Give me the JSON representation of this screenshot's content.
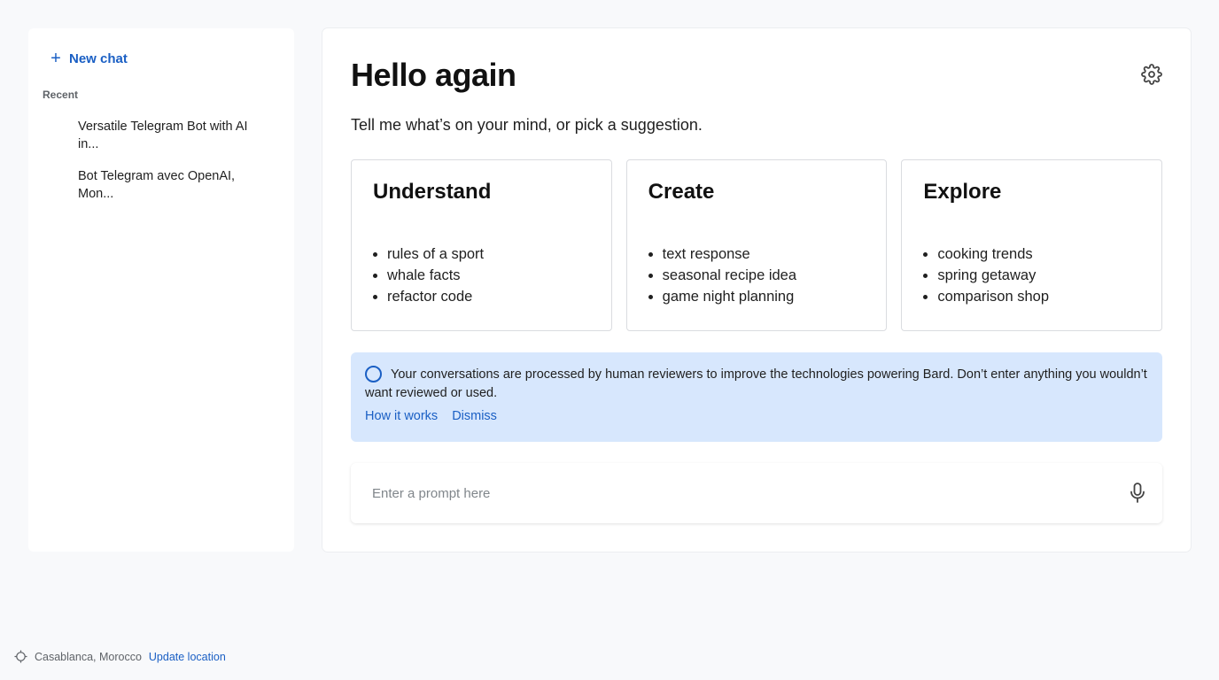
{
  "sidebar": {
    "new_chat_label": "New chat",
    "recent_label": "Recent",
    "items": [
      {
        "label": "Versatile Telegram Bot with AI in..."
      },
      {
        "label": "Bot Telegram avec OpenAI, Mon..."
      }
    ]
  },
  "main": {
    "title": "Hello again",
    "subtitle": "Tell me what’s on your mind, or pick a suggestion.",
    "cards": [
      {
        "title": "Understand",
        "items": [
          "rules of a sport",
          "whale facts",
          "refactor code"
        ]
      },
      {
        "title": "Create",
        "items": [
          "text response",
          "seasonal recipe idea",
          "game night planning"
        ]
      },
      {
        "title": "Explore",
        "items": [
          "cooking trends",
          "spring getaway",
          "comparison shop"
        ]
      }
    ],
    "notice": {
      "text": "Your conversations are processed by human reviewers to improve the technologies powering Bard. Don’t enter anything you wouldn’t want reviewed or used.",
      "how_it_works": "How it works",
      "dismiss": "Dismiss"
    },
    "prompt": {
      "placeholder": "Enter a prompt here",
      "value": ""
    }
  },
  "footer": {
    "location": "Casablanca, Morocco",
    "update_label": "Update location"
  },
  "icons": {
    "new_chat": "plus-icon",
    "settings": "gear-icon",
    "notice": "circle-icon",
    "mic": "microphone-icon",
    "location": "crosshair-icon"
  },
  "colors": {
    "accent": "#1a5fc4",
    "notice_bg": "#d7e7fd",
    "page_bg": "#f8f9fb"
  }
}
